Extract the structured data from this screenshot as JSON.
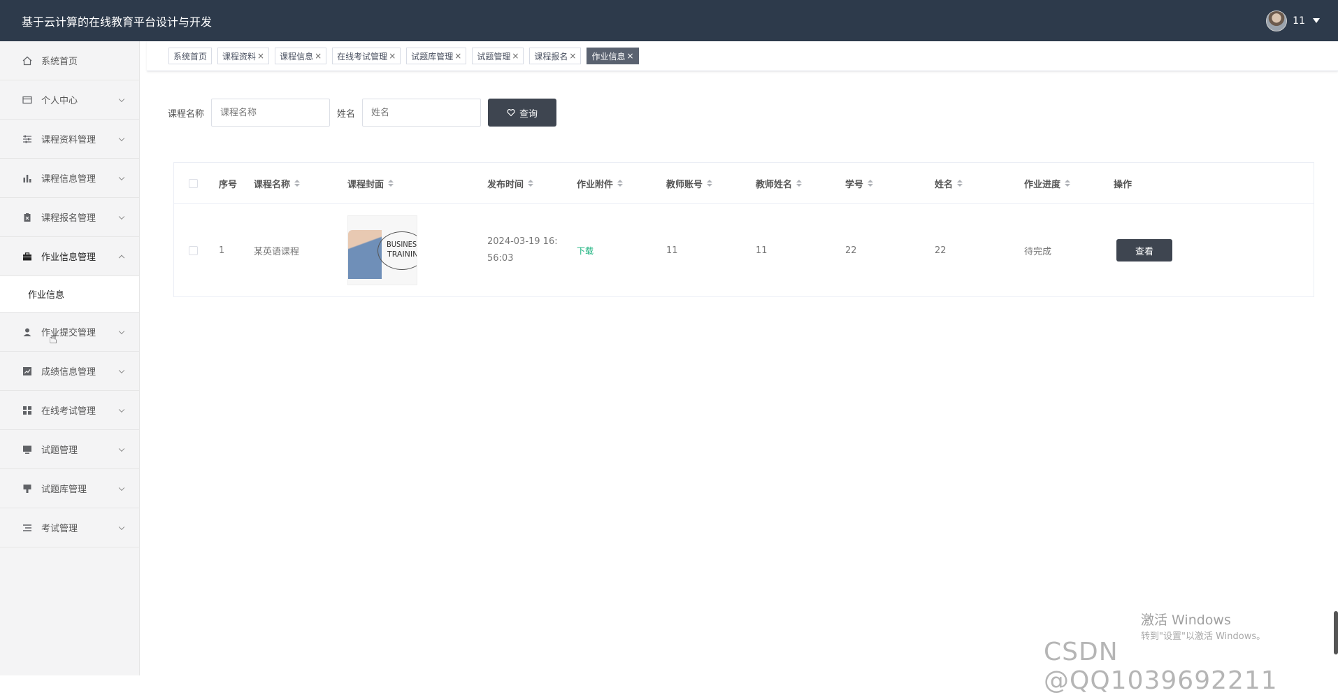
{
  "header": {
    "title": "基于云计算的在线教育平台设计与开发",
    "user": "11"
  },
  "sidebar": {
    "items": [
      {
        "label": "系统首页",
        "icon": "home-icon"
      },
      {
        "label": "个人中心",
        "icon": "card-icon"
      },
      {
        "label": "课程资料管理",
        "icon": "sliders-icon"
      },
      {
        "label": "课程信息管理",
        "icon": "bar-chart-icon"
      },
      {
        "label": "课程报名管理",
        "icon": "clipboard-icon"
      },
      {
        "label": "作业信息管理",
        "icon": "briefcase-icon"
      },
      {
        "label": "作业提交管理",
        "icon": "user-icon"
      },
      {
        "label": "成绩信息管理",
        "icon": "line-chart-icon"
      },
      {
        "label": "在线考试管理",
        "icon": "grid-icon"
      },
      {
        "label": "试题管理",
        "icon": "monitor-icon"
      },
      {
        "label": "试题库管理",
        "icon": "stamp-icon"
      },
      {
        "label": "考试管理",
        "icon": "list-icon"
      }
    ],
    "submenu": {
      "label": "作业信息"
    }
  },
  "tags": [
    {
      "label": "系统首页",
      "close": ""
    },
    {
      "label": "课程资料",
      "close": "×"
    },
    {
      "label": "课程信息",
      "close": "×"
    },
    {
      "label": "在线考试管理",
      "close": "×"
    },
    {
      "label": "试题库管理",
      "close": "×"
    },
    {
      "label": "试题管理",
      "close": "×"
    },
    {
      "label": "课程报名",
      "close": "×"
    },
    {
      "label": "作业信息",
      "close": "×"
    }
  ],
  "search": {
    "course_label": "课程名称",
    "course_placeholder": "课程名称",
    "name_label": "姓名",
    "name_placeholder": "姓名",
    "button": "查询"
  },
  "table": {
    "headers": [
      "序号",
      "课程名称",
      "课程封面",
      "发布时间",
      "作业附件",
      "教师账号",
      "教师姓名",
      "学号",
      "姓名",
      "作业进度",
      "操作"
    ],
    "rows": [
      {
        "index": "1",
        "course": "某英语课程",
        "cover_text_1": "BUSINESS",
        "cover_text_2": "TRAINING",
        "date_line1": "2024-03-19 16:",
        "date_line2": "56:03",
        "attachment": "下载",
        "teacher_account": "11",
        "teacher_name": "11",
        "student_no": "22",
        "student_name": "22",
        "progress": "待完成",
        "action": "查看"
      }
    ]
  },
  "watermark": {
    "line1": "激活 Windows",
    "line2": "转到\"设置\"以激活 Windows。",
    "csdn": "CSDN @QQ1039692211"
  }
}
